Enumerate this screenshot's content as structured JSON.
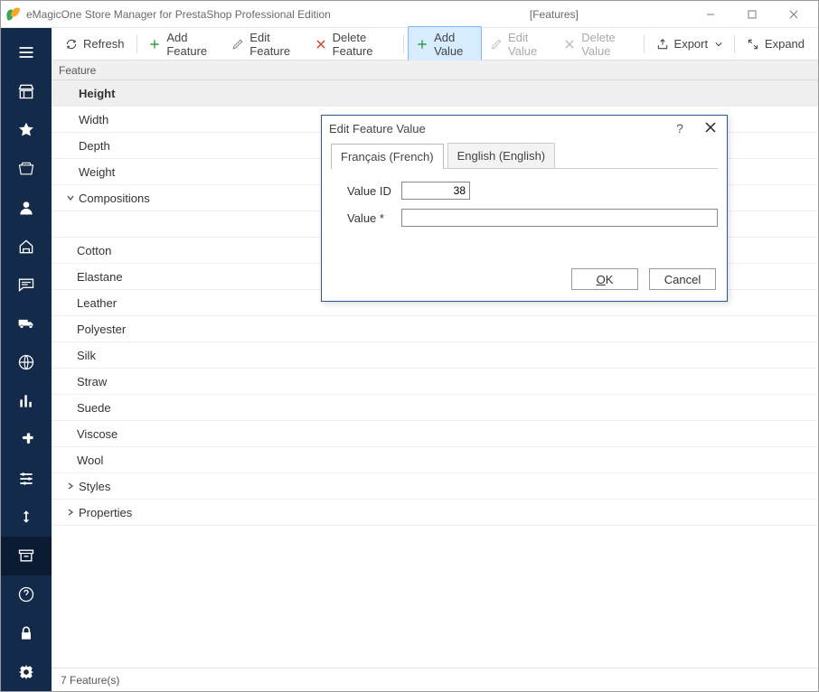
{
  "window": {
    "title": "eMagicOne Store Manager for PrestaShop Professional Edition",
    "title_suffix": "[Features]"
  },
  "toolbar": {
    "refresh": "Refresh",
    "add_feature": "Add Feature",
    "edit_feature": "Edit Feature",
    "delete_feature": "Delete Feature",
    "add_value": "Add Value",
    "edit_value": "Edit Value",
    "delete_value": "Delete Value",
    "export": "Export",
    "expand": "Expand"
  },
  "table": {
    "column_header": "Feature",
    "rows": [
      {
        "label": "Height",
        "level": 1,
        "selected": true
      },
      {
        "label": "Width",
        "level": 1
      },
      {
        "label": "Depth",
        "level": 1
      },
      {
        "label": "Weight",
        "level": 1
      },
      {
        "label": "Compositions",
        "level": 1,
        "expandable": true,
        "expanded": true
      },
      {
        "label": "",
        "level": 2
      },
      {
        "label": "Cotton",
        "level": 2
      },
      {
        "label": "Elastane",
        "level": 2
      },
      {
        "label": "Leather",
        "level": 2
      },
      {
        "label": "Polyester",
        "level": 2
      },
      {
        "label": "Silk",
        "level": 2
      },
      {
        "label": "Straw",
        "level": 2
      },
      {
        "label": "Suede",
        "level": 2
      },
      {
        "label": "Viscose",
        "level": 2
      },
      {
        "label": "Wool",
        "level": 2
      },
      {
        "label": "Styles",
        "level": 1,
        "expandable": true,
        "expanded": false
      },
      {
        "label": "Properties",
        "level": 1,
        "expandable": true,
        "expanded": false
      }
    ]
  },
  "statusbar": {
    "text": "7 Feature(s)"
  },
  "dialog": {
    "title": "Edit Feature Value",
    "help_char": "?",
    "tabs": [
      {
        "label": "Français (French)",
        "active": true
      },
      {
        "label": "English (English)",
        "active": false
      }
    ],
    "fields": {
      "value_id_label": "Value ID",
      "value_id": "38",
      "value_label": "Value *",
      "value": ""
    },
    "buttons": {
      "ok_prefix": "O",
      "ok_rest": "K",
      "cancel": "Cancel"
    }
  },
  "sidebar": {
    "items": [
      {
        "name": "menu"
      },
      {
        "name": "store"
      },
      {
        "name": "star"
      },
      {
        "name": "orders"
      },
      {
        "name": "customers"
      },
      {
        "name": "home-cart"
      },
      {
        "name": "messages"
      },
      {
        "name": "shipping"
      },
      {
        "name": "globe"
      },
      {
        "name": "reports"
      },
      {
        "name": "plugin"
      },
      {
        "name": "sliders"
      },
      {
        "name": "sync"
      },
      {
        "name": "archive",
        "active": true
      },
      {
        "name": "help"
      },
      {
        "name": "lock"
      },
      {
        "name": "settings"
      }
    ]
  }
}
